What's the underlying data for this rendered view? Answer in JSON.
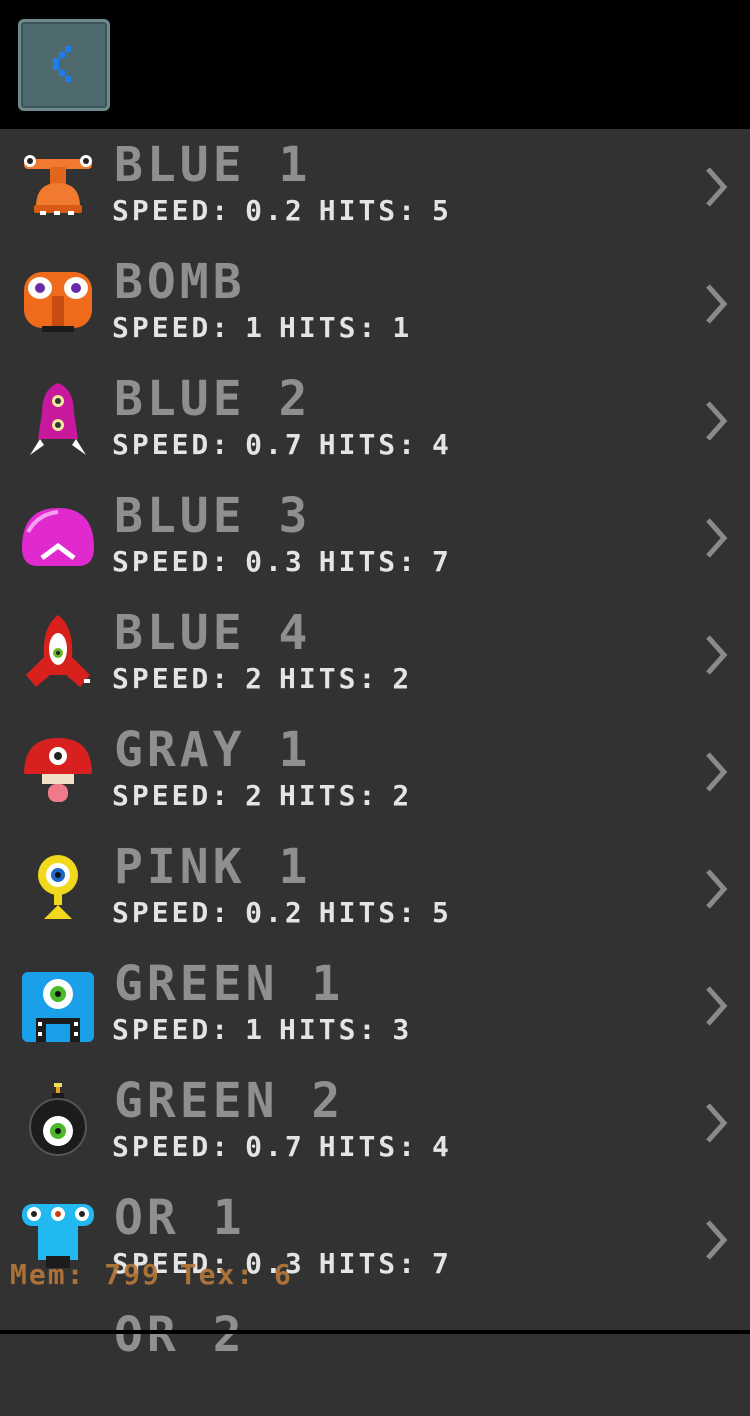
{
  "header": {
    "back_icon": "chevron-left-icon"
  },
  "labels": {
    "speed": "SPEED:",
    "hits": "HITS:"
  },
  "enemies": [
    {
      "name": "BLUE 1",
      "speed": "0.2",
      "hits": "5",
      "icon": "orange-hammerhead-icon",
      "color": "#f07a2e"
    },
    {
      "name": "BOMB",
      "speed": "1",
      "hits": "1",
      "icon": "orange-face-icon",
      "color": "#f06a1c"
    },
    {
      "name": "BLUE 2",
      "speed": "0.7",
      "hits": "4",
      "icon": "magenta-rocket-icon",
      "color": "#c8189e"
    },
    {
      "name": "BLUE 3",
      "speed": "0.3",
      "hits": "7",
      "icon": "magenta-dome-icon",
      "color": "#e02ad0"
    },
    {
      "name": "BLUE 4",
      "speed": "2",
      "hits": "2",
      "icon": "red-ship-icon",
      "color": "#d8201c"
    },
    {
      "name": "GRAY 1",
      "speed": "2",
      "hits": "2",
      "icon": "red-mushroom-icon",
      "color": "#d82020"
    },
    {
      "name": "PINK 1",
      "speed": "0.2",
      "hits": "5",
      "icon": "yellow-eye-icon",
      "color": "#f0d81c"
    },
    {
      "name": "GREEN 1",
      "speed": "1",
      "hits": "3",
      "icon": "blue-box-eye-icon",
      "color": "#1aa0e8"
    },
    {
      "name": "GREEN 2",
      "speed": "0.7",
      "hits": "4",
      "icon": "black-bomb-eye-icon",
      "color": "#1c1c1c"
    },
    {
      "name": "OR 1",
      "speed": "0.3",
      "hits": "7",
      "icon": "cyan-creature-icon",
      "color": "#22b8f0"
    },
    {
      "name": "OR 2",
      "speed": "",
      "hits": "",
      "icon": "partial-row-icon",
      "color": "#8f8f8f"
    }
  ],
  "debug": {
    "mem_text": "Mem: 799 Tex: 6"
  }
}
